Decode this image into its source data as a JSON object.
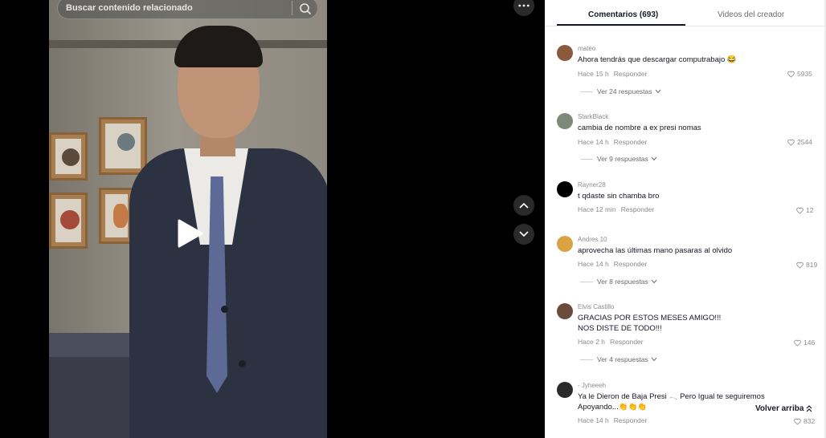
{
  "search": {
    "placeholder": "Buscar contenido relacionado"
  },
  "tabs": [
    {
      "label": "Comentarios (693)",
      "active": true
    },
    {
      "label": "Videos del creador",
      "active": false
    }
  ],
  "comments": [
    {
      "user": "mateo",
      "text": "Ahora tendrás que descargar computrabajo 😂",
      "time": "Hace 15 h",
      "reply": "Responder",
      "likes": "5935",
      "replies": "Ver 24 respuestas",
      "avatar_color": "#8b5a3c"
    },
    {
      "user": "StarkBlack",
      "text": "cambia de nombre a ex presi nomas",
      "time": "Hace 14 h",
      "reply": "Responder",
      "likes": "2544",
      "replies": "Ver 9 respuestas",
      "avatar_color": "#7d8a7a"
    },
    {
      "user": "Rayner28",
      "text": "t qdaste sin chamba bro",
      "time": "Hace 12 min",
      "reply": "Responder",
      "likes": "12",
      "avatar_color": "#000000"
    },
    {
      "user": "Andres.10",
      "text": "aprovecha las últimas mano pasaras al olvido",
      "time": "Hace 14 h",
      "reply": "Responder",
      "likes": "819",
      "replies": "Ver 8 respuestas",
      "avatar_color": "#d9a441"
    },
    {
      "user": "Elvis Castillo",
      "text": "GRACIAS POR ESTOS MESES AMIGO!!!",
      "text2": "NOS DISTE DE TODO!!!",
      "time": "Hace 2 h",
      "reply": "Responder",
      "likes": "146",
      "replies": "Ver 4 respuestas",
      "avatar_color": "#6b4b3a"
    },
    {
      "user": "- Jyheeeh",
      "text": "Ya le Dieron de Baja Presi 𓂃 Pero Igual te seguiremos",
      "text2": "Apoyando...👏👏👏",
      "time": "Hace 14 h",
      "reply": "Responder",
      "likes": "832",
      "avatar_color": "#2b2b2b"
    }
  ],
  "back_to_top": "Volver arriba",
  "colors": {
    "panel_bg": "#ffffff",
    "text": "#161823",
    "muted": "#8a8b91"
  }
}
